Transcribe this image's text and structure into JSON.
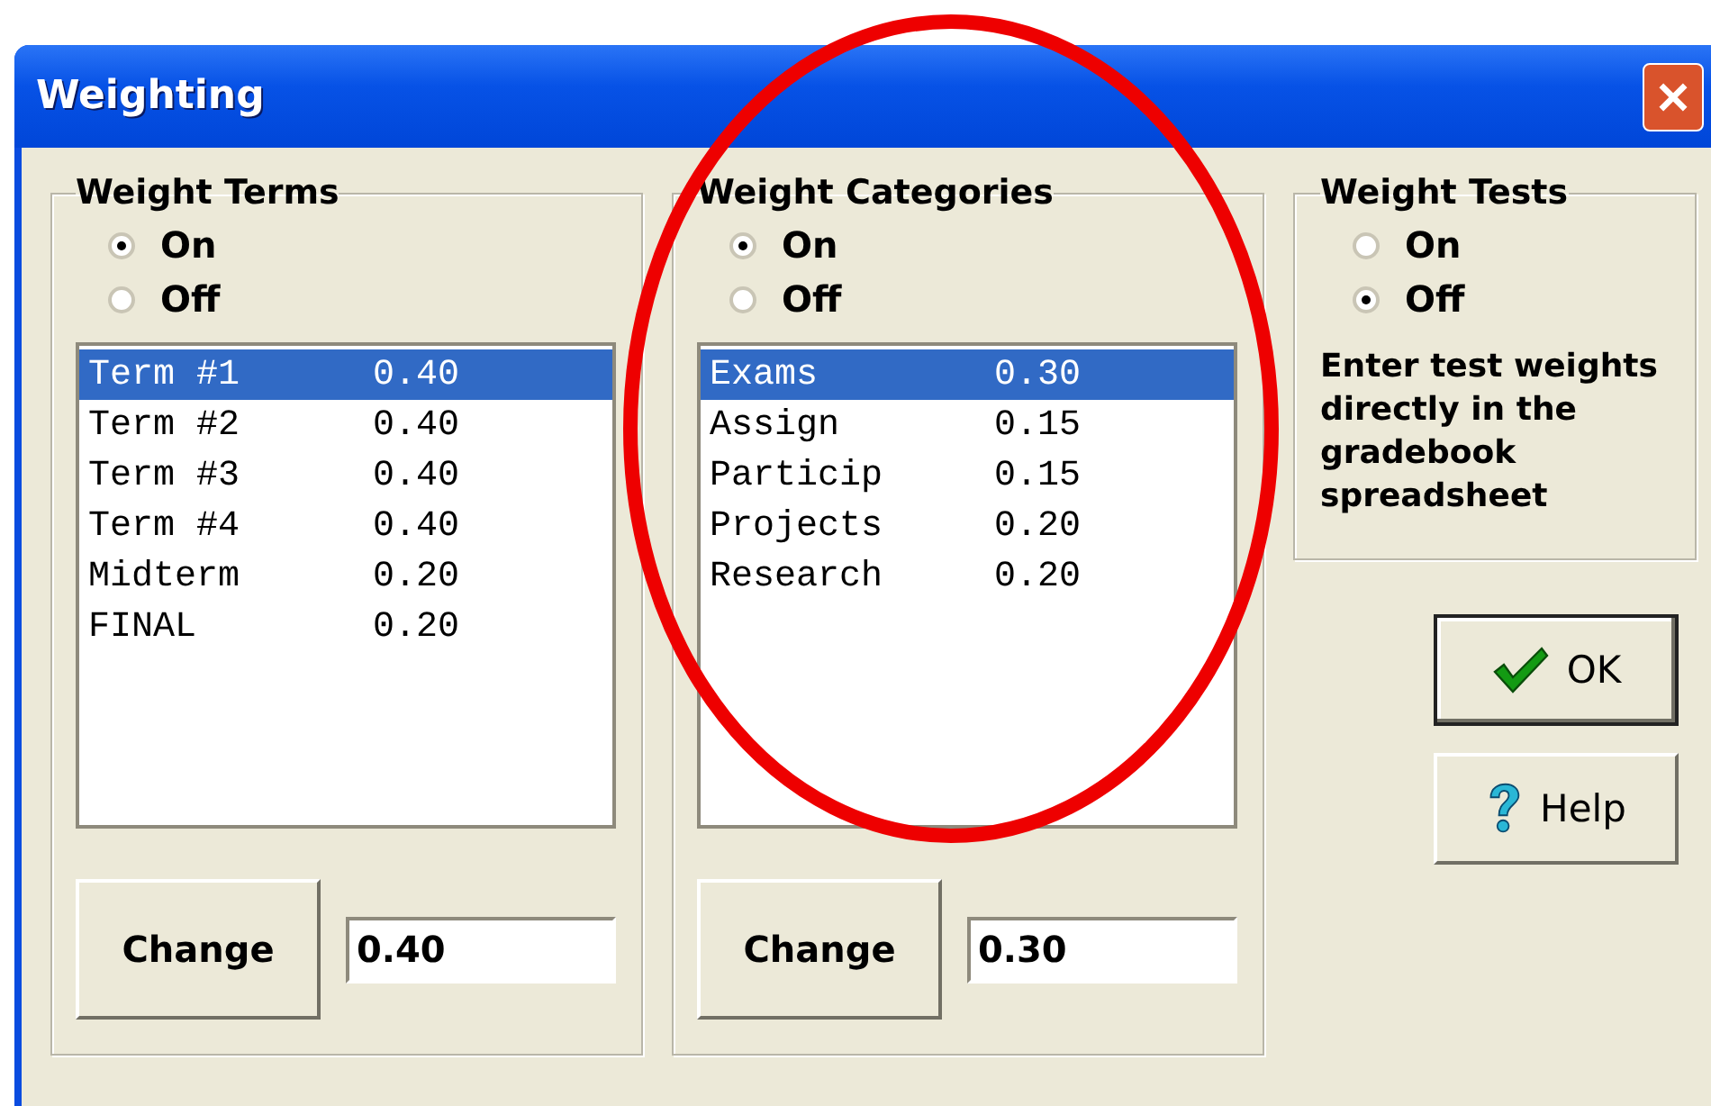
{
  "window": {
    "title": "Weighting"
  },
  "groups": [
    {
      "kind": "list",
      "title": "Weight Terms",
      "options": [
        {
          "label": "On",
          "selected": true
        },
        {
          "label": "Off",
          "selected": false
        }
      ],
      "items": [
        {
          "name": "Term #1",
          "value": "0.40",
          "selected": true
        },
        {
          "name": "Term #2",
          "value": "0.40",
          "selected": false
        },
        {
          "name": "Term #3",
          "value": "0.40",
          "selected": false
        },
        {
          "name": "Term #4",
          "value": "0.40",
          "selected": false
        },
        {
          "name": "Midterm",
          "value": "0.20",
          "selected": false
        },
        {
          "name": "FINAL",
          "value": "0.20",
          "selected": false
        }
      ],
      "button": "Change",
      "field_value": "0.40"
    },
    {
      "kind": "list",
      "title": "Weight Categories",
      "options": [
        {
          "label": "On",
          "selected": true
        },
        {
          "label": "Off",
          "selected": false
        }
      ],
      "items": [
        {
          "name": "Exams",
          "value": "0.30",
          "selected": true
        },
        {
          "name": "Assign",
          "value": "0.15",
          "selected": false
        },
        {
          "name": "Particip",
          "value": "0.15",
          "selected": false
        },
        {
          "name": "Projects",
          "value": "0.20",
          "selected": false
        },
        {
          "name": "Research",
          "value": "0.20",
          "selected": false
        }
      ],
      "button": "Change",
      "field_value": "0.30"
    },
    {
      "kind": "note",
      "title": "Weight Tests",
      "options": [
        {
          "label": "On",
          "selected": false
        },
        {
          "label": "Off",
          "selected": true
        }
      ],
      "note": "Enter test weights directly in the gradebook spreadsheet"
    }
  ],
  "buttons": [
    {
      "label": "OK",
      "kind": "ok",
      "default": true
    },
    {
      "label": "Help",
      "kind": "help",
      "default": false
    }
  ]
}
